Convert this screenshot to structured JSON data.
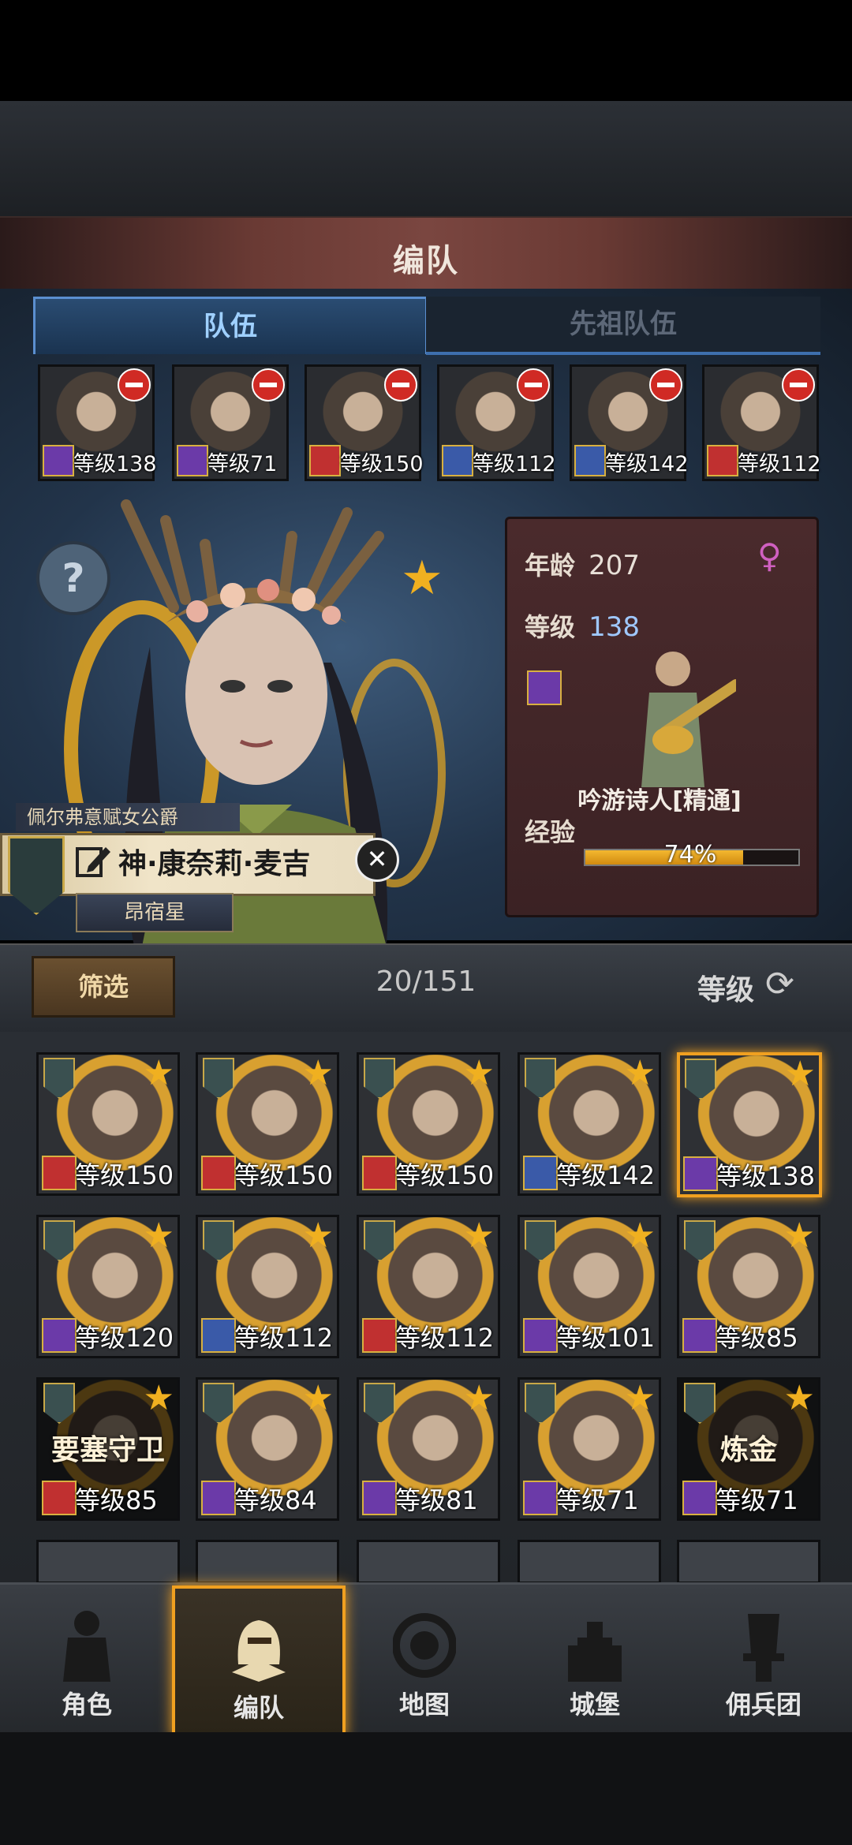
{
  "screen": {
    "title": "编队"
  },
  "tabs": [
    {
      "label": "队伍",
      "active": true
    },
    {
      "label": "先祖队伍",
      "active": false
    }
  ],
  "team": [
    {
      "class": "staff",
      "level_text": "等级138",
      "color": "#6b3aa8"
    },
    {
      "class": "staff",
      "level_text": "等级71",
      "color": "#6b3aa8"
    },
    {
      "class": "beast",
      "level_text": "等级150",
      "color": "#c03030"
    },
    {
      "class": "sword",
      "level_text": "等级112",
      "color": "#3a5aa8"
    },
    {
      "class": "sword",
      "level_text": "等级142",
      "color": "#3a5aa8"
    },
    {
      "class": "beast",
      "level_text": "等级112",
      "color": "#c03030"
    }
  ],
  "hero": {
    "title": "佩尔弗意赋女公爵",
    "name": "神·康奈莉·麦吉",
    "constellation": "昂宿星",
    "age_label": "年龄",
    "age": "207",
    "level_label": "等级",
    "level": "138",
    "class_name": "吟游诗人[精通]",
    "xp_label": "经验",
    "xp_text": "74%",
    "xp_percent": 74
  },
  "filter": {
    "button": "筛选",
    "count": "20/151",
    "sort_label": "等级",
    "sort_icon": "refresh-icon"
  },
  "roster": [
    {
      "level_text": "等级150",
      "cls_color": "#c03030",
      "locked": false,
      "selected": false
    },
    {
      "level_text": "等级150",
      "cls_color": "#c03030",
      "locked": false,
      "selected": false
    },
    {
      "level_text": "等级150",
      "cls_color": "#c03030",
      "locked": false,
      "selected": false
    },
    {
      "level_text": "等级142",
      "cls_color": "#3a5aa8",
      "locked": false,
      "selected": false
    },
    {
      "level_text": "等级138",
      "cls_color": "#6b3aa8",
      "locked": false,
      "selected": true
    },
    {
      "level_text": "等级120",
      "cls_color": "#6b3aa8",
      "locked": false,
      "selected": false
    },
    {
      "level_text": "等级112",
      "cls_color": "#3a5aa8",
      "locked": false,
      "selected": false
    },
    {
      "level_text": "等级112",
      "cls_color": "#c03030",
      "locked": false,
      "selected": false
    },
    {
      "level_text": "等级101",
      "cls_color": "#6b3aa8",
      "locked": false,
      "selected": false
    },
    {
      "level_text": "等级85",
      "cls_color": "#6b3aa8",
      "locked": false,
      "selected": false
    },
    {
      "level_text": "等级85",
      "cls_color": "#c03030",
      "locked": true,
      "selected": false,
      "lock_label": "要塞守卫"
    },
    {
      "level_text": "等级84",
      "cls_color": "#6b3aa8",
      "locked": false,
      "selected": false
    },
    {
      "level_text": "等级81",
      "cls_color": "#6b3aa8",
      "locked": false,
      "selected": false
    },
    {
      "level_text": "等级71",
      "cls_color": "#6b3aa8",
      "locked": false,
      "selected": false
    },
    {
      "level_text": "等级71",
      "cls_color": "#6b3aa8",
      "locked": true,
      "selected": false,
      "lock_label": "炼金"
    }
  ],
  "nav": [
    {
      "label": "角色",
      "icon": "knight-icon",
      "active": false
    },
    {
      "label": "编队",
      "icon": "helmet-icon",
      "active": true
    },
    {
      "label": "地图",
      "icon": "compass-icon",
      "active": false
    },
    {
      "label": "城堡",
      "icon": "castle-icon",
      "active": false
    },
    {
      "label": "佣兵团",
      "icon": "mercenary-icon",
      "active": false
    }
  ],
  "colors": {
    "accent": "#f0a020",
    "tab_active": "#9fd0ff",
    "level_value": "#9fc8ff"
  }
}
